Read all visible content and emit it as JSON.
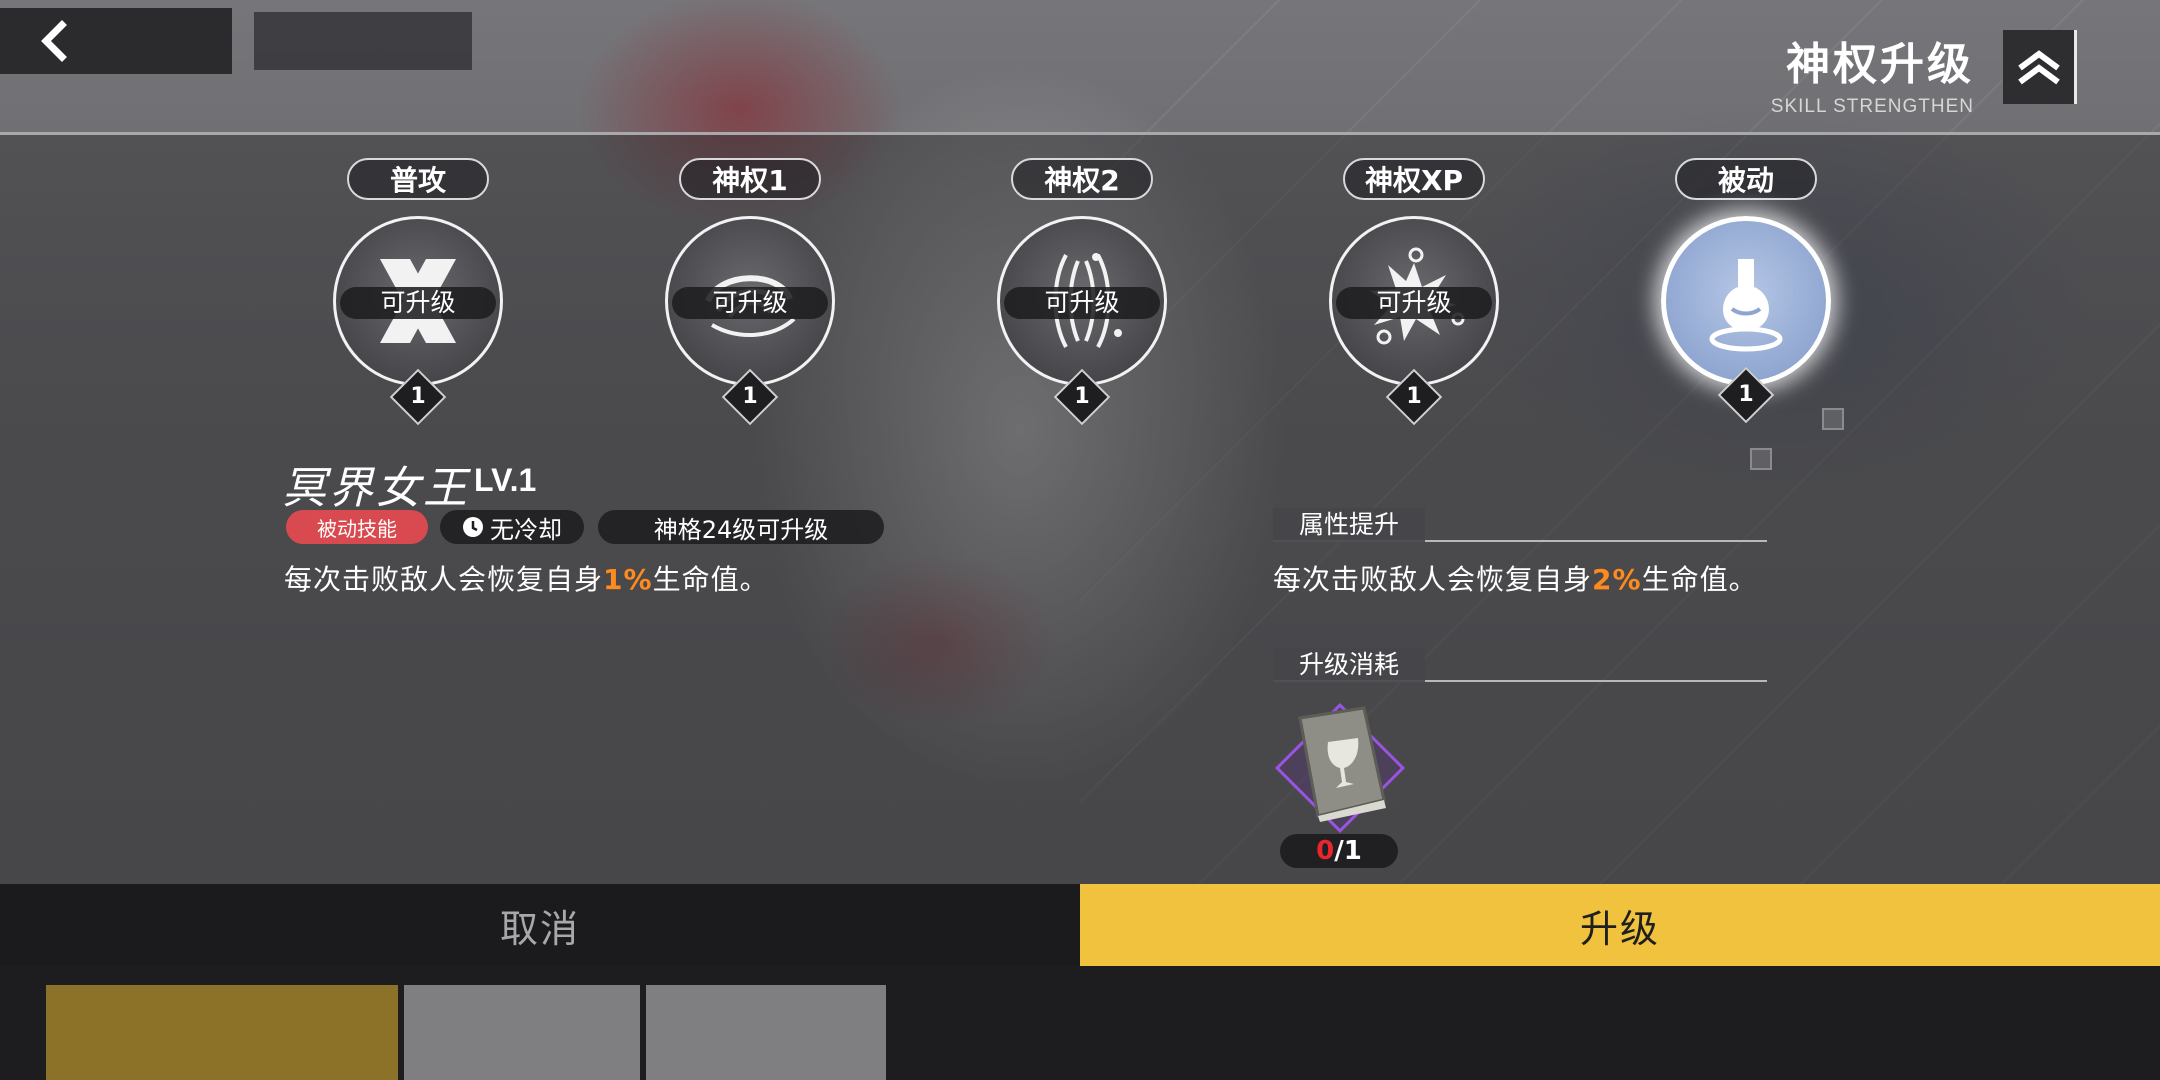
{
  "header": {
    "title": "神权升级",
    "subtitle": "SKILL STRENGTHEN",
    "back_icon": "chevron-left-icon",
    "rank_icon": "double-chevron-up-icon"
  },
  "skills": [
    {
      "label": "普攻",
      "badge": "可升级",
      "level": "1",
      "icon": "cross-slash-icon"
    },
    {
      "label": "神权1",
      "badge": "可升级",
      "level": "1",
      "icon": "vortex-icon"
    },
    {
      "label": "神权2",
      "badge": "可升级",
      "level": "1",
      "icon": "tornado-icon"
    },
    {
      "label": "神权XP",
      "badge": "可升级",
      "level": "1",
      "icon": "burst-icon"
    },
    {
      "label": "被动",
      "badge": "",
      "level": "1",
      "icon": "potion-flask-icon",
      "selected": true
    }
  ],
  "detail": {
    "name": "冥界女王",
    "level_text": "LV.1",
    "type_tag": "被动技能",
    "cooldown_tag": "无冷却",
    "requirement_tag": "神格24级可升级",
    "desc_prefix": "每次击败敌人会恢复自身",
    "desc_value": "1%",
    "desc_suffix": "生命值。"
  },
  "upgrade": {
    "attr_heading": "属性提升",
    "attr_prefix": "每次击败敌人会恢复自身",
    "attr_value": "2%",
    "attr_suffix": "生命值。",
    "cost_heading": "升级消耗",
    "cost_item_icon": "grail-book-icon",
    "cost_have": "0",
    "cost_need": "/1"
  },
  "buttons": {
    "cancel": "取消",
    "confirm": "升级"
  },
  "colors": {
    "accent_yellow": "#f0c23e",
    "highlight_orange": "#ff8a1e",
    "tag_red": "#d84a4f",
    "insufficient_red": "#e8262c"
  }
}
